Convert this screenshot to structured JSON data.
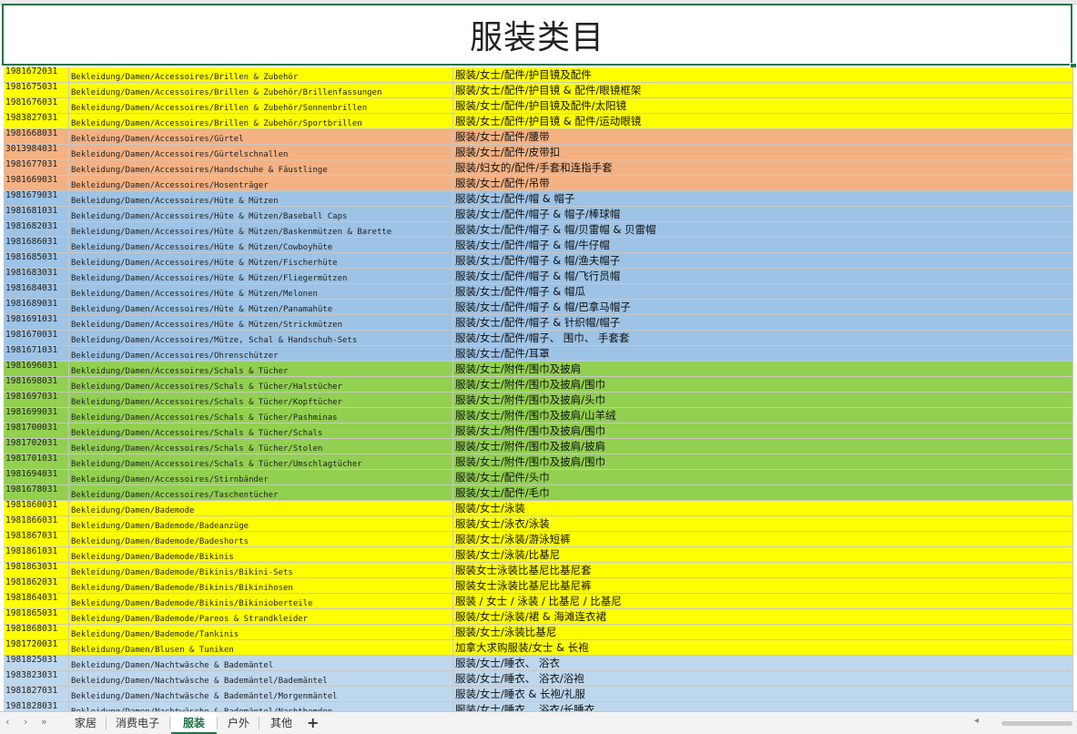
{
  "title": "服装类目",
  "colors": {
    "yellow": "#ffff00",
    "orange": "#f4b183",
    "blue": "#9dc3e6",
    "green": "#92d050",
    "lightblue": "#bdd7ee",
    "accent": "#217346"
  },
  "rows": [
    {
      "id": "1981672031",
      "de": "Bekleidung/Damen/Accessoires/Brillen & Zubehör",
      "zh": "服装/女士/配件/护目镜及配件",
      "color": "yellow"
    },
    {
      "id": "1981675031",
      "de": "Bekleidung/Damen/Accessoires/Brillen & Zubehör/Brillenfassungen",
      "zh": "服装/女士/配件/护目镜 & 配件/眼镜框架",
      "color": "yellow"
    },
    {
      "id": "1981676031",
      "de": "Bekleidung/Damen/Accessoires/Brillen & Zubehör/Sonnenbrillen",
      "zh": "服装/女士/配件/护目镜及配件/太阳镜",
      "color": "yellow"
    },
    {
      "id": "1983827031",
      "de": "Bekleidung/Damen/Accessoires/Brillen & Zubehör/Sportbrillen",
      "zh": "服装/女士/配件/护目镜 & 配件/运动眼镜",
      "color": "yellow"
    },
    {
      "id": "1981668031",
      "de": "Bekleidung/Damen/Accessoires/Gürtel",
      "zh": "服装/女士/配件/腰带",
      "color": "orange"
    },
    {
      "id": "3013984031",
      "de": "Bekleidung/Damen/Accessoires/Gürtelschnallen",
      "zh": "服装/女士/配件/皮带扣",
      "color": "orange"
    },
    {
      "id": "1981677031",
      "de": "Bekleidung/Damen/Accessoires/Handschuhe & Fäustlinge",
      "zh": "服装/妇女的/配件/手套和连指手套",
      "color": "orange"
    },
    {
      "id": "1981669031",
      "de": "Bekleidung/Damen/Accessoires/Hosenträger",
      "zh": "服装/女士/配件/吊带",
      "color": "orange"
    },
    {
      "id": "1981679031",
      "de": "Bekleidung/Damen/Accessoires/Hüte & Mützen",
      "zh": "服装/女士/配件/帽 & 帽子",
      "color": "blue"
    },
    {
      "id": "1981681031",
      "de": "Bekleidung/Damen/Accessoires/Hüte & Mützen/Baseball Caps",
      "zh": "服装/女士/配件/帽子 & 帽子/棒球帽",
      "color": "blue"
    },
    {
      "id": "1981682031",
      "de": "Bekleidung/Damen/Accessoires/Hüte & Mützen/Baskenmützen & Barette",
      "zh": "服装/女士/配件/帽子 & 帽/贝雷帽 & 贝雷帽",
      "color": "blue"
    },
    {
      "id": "1981686031",
      "de": "Bekleidung/Damen/Accessoires/Hüte & Mützen/Cowboyhüte",
      "zh": "服装/女士/配件/帽子 & 帽/牛仔帽",
      "color": "blue"
    },
    {
      "id": "1981685031",
      "de": "Bekleidung/Damen/Accessoires/Hüte & Mützen/Fischerhüte",
      "zh": "服装/女士/配件/帽子 & 帽/渔夫帽子",
      "color": "blue"
    },
    {
      "id": "1981683031",
      "de": "Bekleidung/Damen/Accessoires/Hüte & Mützen/Fliegermützen",
      "zh": "服装/女士/配件/帽子 & 帽/飞行员帽",
      "color": "blue"
    },
    {
      "id": "1981684031",
      "de": "Bekleidung/Damen/Accessoires/Hüte & Mützen/Melonen",
      "zh": "服装/女士/配件/帽子 & 帽瓜",
      "color": "blue"
    },
    {
      "id": "1981689031",
      "de": "Bekleidung/Damen/Accessoires/Hüte & Mützen/Panamahüte",
      "zh": "服装/女士/配件/帽子 & 帽/巴拿马帽子",
      "color": "blue"
    },
    {
      "id": "1981691031",
      "de": "Bekleidung/Damen/Accessoires/Hüte & Mützen/Strickmützen",
      "zh": "服装/女士/配件/帽子 & 针织帽/帽子",
      "color": "blue"
    },
    {
      "id": "1981670031",
      "de": "Bekleidung/Damen/Accessoires/Mütze, Schal & Handschuh-Sets",
      "zh": "服装/女士/配件/帽子、 围巾、 手套套",
      "color": "blue"
    },
    {
      "id": "1981671031",
      "de": "Bekleidung/Damen/Accessoires/Ohrenschützer",
      "zh": "服装/女士/配件/耳罩",
      "color": "blue"
    },
    {
      "id": "1981696031",
      "de": "Bekleidung/Damen/Accessoires/Schals & Tücher",
      "zh": "服装/女士/附件/围巾及披肩",
      "color": "green"
    },
    {
      "id": "1981698031",
      "de": "Bekleidung/Damen/Accessoires/Schals & Tücher/Halstücher",
      "zh": "服装/女士/附件/围巾及披肩/围巾",
      "color": "green"
    },
    {
      "id": "1981697031",
      "de": "Bekleidung/Damen/Accessoires/Schals & Tücher/Kopftücher",
      "zh": "服装/女士/附件/围巾及披肩/头巾",
      "color": "green"
    },
    {
      "id": "1981699031",
      "de": "Bekleidung/Damen/Accessoires/Schals & Tücher/Pashminas",
      "zh": "服装/女士/附件/围巾及披肩/山羊绒",
      "color": "green"
    },
    {
      "id": "1981700031",
      "de": "Bekleidung/Damen/Accessoires/Schals & Tücher/Schals",
      "zh": "服装/女士/附件/围巾及披肩/围巾",
      "color": "green"
    },
    {
      "id": "1981702031",
      "de": "Bekleidung/Damen/Accessoires/Schals & Tücher/Stolen",
      "zh": "服装/女士/附件/围巾及披肩/披肩",
      "color": "green"
    },
    {
      "id": "1981701031",
      "de": "Bekleidung/Damen/Accessoires/Schals & Tücher/Umschlagtücher",
      "zh": "服装/女士/附件/围巾及披肩/围巾",
      "color": "green"
    },
    {
      "id": "1981694031",
      "de": "Bekleidung/Damen/Accessoires/Stirnbänder",
      "zh": "服装/女士/配件/头巾",
      "color": "green"
    },
    {
      "id": "1981678031",
      "de": "Bekleidung/Damen/Accessoires/Taschentücher",
      "zh": "服装/女士/配件/毛巾",
      "color": "green"
    },
    {
      "id": "1981860031",
      "de": "Bekleidung/Damen/Bademode",
      "zh": "服装/女士/泳装",
      "color": "yellow"
    },
    {
      "id": "1981866031",
      "de": "Bekleidung/Damen/Bademode/Badeanzüge",
      "zh": "服装/女士/泳衣/泳装",
      "color": "yellow"
    },
    {
      "id": "1981867031",
      "de": "Bekleidung/Damen/Bademode/Badeshorts",
      "zh": "服装/女士/泳装/游泳短裤",
      "color": "yellow"
    },
    {
      "id": "1981861031",
      "de": "Bekleidung/Damen/Bademode/Bikinis",
      "zh": "服装/女士/泳装/比基尼",
      "color": "yellow"
    },
    {
      "id": "1981863031",
      "de": "Bekleidung/Damen/Bademode/Bikinis/Bikini-Sets",
      "zh": "服装女士泳装比基尼比基尼套",
      "color": "yellow"
    },
    {
      "id": "1981862031",
      "de": "Bekleidung/Damen/Bademode/Bikinis/Bikinihosen",
      "zh": "服装女士泳装比基尼比基尼裤",
      "color": "yellow"
    },
    {
      "id": "1981864031",
      "de": "Bekleidung/Damen/Bademode/Bikinis/Bikinioberteile",
      "zh": "服装 / 女士 / 泳装 / 比基尼 / 比基尼",
      "color": "yellow"
    },
    {
      "id": "1981865031",
      "de": "Bekleidung/Damen/Bademode/Pareos & Strandkleider",
      "zh": "服装/女士/泳装/裙 & 海滩连衣裙",
      "color": "yellow"
    },
    {
      "id": "1981868031",
      "de": "Bekleidung/Damen/Bademode/Tankinis",
      "zh": "服装/女士/泳装比基尼",
      "color": "yellow"
    },
    {
      "id": "1981720031",
      "de": "Bekleidung/Damen/Blusen & Tuniken",
      "zh": "加拿大求购服装/女士 & 长袍",
      "color": "yellow"
    },
    {
      "id": "1981825031",
      "de": "Bekleidung/Damen/Nachtwäsche & Bademäntel",
      "zh": "服装/女士/睡衣、 浴衣",
      "color": "lightblue"
    },
    {
      "id": "1983823031",
      "de": "Bekleidung/Damen/Nachtwäsche & Bademäntel/Bademäntel",
      "zh": "服装/女士/睡衣、 浴衣/浴袍",
      "color": "lightblue"
    },
    {
      "id": "1981827031",
      "de": "Bekleidung/Damen/Nachtwäsche & Bademäntel/Morgenmäntel",
      "zh": "服装/女士/睡衣 & 长袍/礼服",
      "color": "lightblue"
    },
    {
      "id": "1981828031",
      "de": "Bekleidung/Damen/Nachtwäsche & Bademäntel/Nachthemden",
      "zh": "服装/女士/睡衣、 浴衣/长睡衣",
      "color": "lightblue"
    }
  ],
  "tabs": [
    {
      "label": "家居",
      "active": false
    },
    {
      "label": "消费电子",
      "active": false
    },
    {
      "label": "服装",
      "active": true
    },
    {
      "label": "户外",
      "active": false
    },
    {
      "label": "其他",
      "active": false
    }
  ],
  "tab_controls": {
    "prev": "‹",
    "next": "›",
    "first": "«",
    "last": "»",
    "add": "+"
  }
}
